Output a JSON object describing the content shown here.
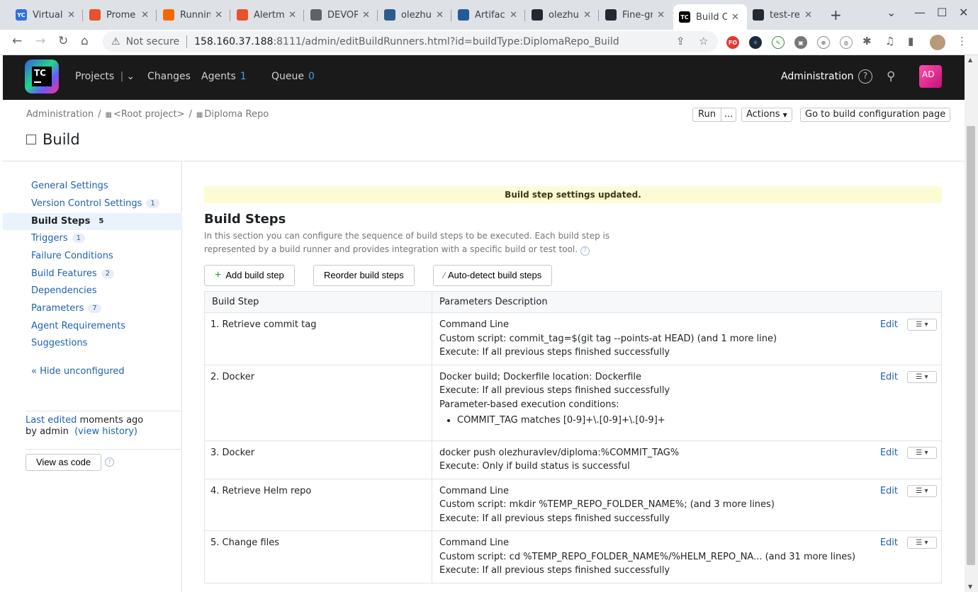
{
  "browser": {
    "tabs": [
      {
        "title": "Virtual",
        "icon": "yandex-cloud-icon",
        "color": "#2f6fe4",
        "glyph": "YC"
      },
      {
        "title": "Prome",
        "icon": "prometheus-icon",
        "color": "#e6522c",
        "glyph": ""
      },
      {
        "title": "Runnin",
        "icon": "grafana-icon",
        "color": "#f46800",
        "glyph": ""
      },
      {
        "title": "Alertm",
        "icon": "prometheus-icon",
        "color": "#e6522c",
        "glyph": ""
      },
      {
        "title": "DEVOP",
        "icon": "globe-icon",
        "color": "#5f6368",
        "glyph": ""
      },
      {
        "title": "olezhu",
        "icon": "docker-icon",
        "color": "#2e5c8a",
        "glyph": ""
      },
      {
        "title": "Artifac",
        "icon": "package-icon",
        "color": "#1f5c99",
        "glyph": ""
      },
      {
        "title": "olezhu",
        "icon": "github-icon",
        "color": "#24292f",
        "glyph": ""
      },
      {
        "title": "Fine-gr",
        "icon": "github-icon",
        "color": "#24292f",
        "glyph": ""
      },
      {
        "title": "Build C",
        "icon": "teamcity-icon",
        "color": "#000000",
        "glyph": "TC"
      },
      {
        "title": "test-re",
        "icon": "github-icon",
        "color": "#24292f",
        "glyph": ""
      }
    ],
    "not_secure": "Not secure",
    "url_host": "158.160.37.188",
    "url_rest": ":8111/admin/editBuildRunners.html?id=buildType:DiplomaRepo_Build"
  },
  "header": {
    "logo_text": "TC",
    "projects": "Projects",
    "changes": "Changes",
    "agents": "Agents",
    "agents_count": "1",
    "queue": "Queue",
    "queue_count": "0",
    "administration": "Administration",
    "avatar": "AD"
  },
  "breadcrumb": {
    "administration": "Administration",
    "root": "<Root project>",
    "project": "Diploma Repo"
  },
  "top_actions": {
    "run": "Run",
    "run_more": "...",
    "actions": "Actions",
    "goto": "Go to build configuration page"
  },
  "page_title": "Build",
  "sidebar": {
    "items": [
      {
        "label": "General Settings",
        "count": ""
      },
      {
        "label": "Version Control Settings",
        "count": "1"
      },
      {
        "label": "Build Steps",
        "count": "5"
      },
      {
        "label": "Triggers",
        "count": "1"
      },
      {
        "label": "Failure Conditions",
        "count": ""
      },
      {
        "label": "Build Features",
        "count": "2"
      },
      {
        "label": "Dependencies",
        "count": ""
      },
      {
        "label": "Parameters",
        "count": "7"
      },
      {
        "label": "Agent Requirements",
        "count": ""
      },
      {
        "label": "Suggestions",
        "count": ""
      }
    ],
    "hide_unconfigured": "« Hide unconfigured",
    "last_edited_link": "Last edited",
    "last_edited_rest": " moments ago",
    "by_admin": "by admin",
    "view_history": "(view history)",
    "view_as_code": "View as code"
  },
  "main": {
    "notice": "Build step settings updated.",
    "title": "Build Steps",
    "description": "In this section you can configure the sequence of build steps to be executed. Each build step is represented by a build runner and provides integration with a specific build or test tool.",
    "add_step": "Add build step",
    "reorder": "Reorder build steps",
    "autodetect": "Auto-detect build steps",
    "col_step": "Build Step",
    "col_params": "Parameters Description",
    "edit_label": "Edit",
    "steps": [
      {
        "name": "1. Retrieve commit tag",
        "lines": [
          "Command Line",
          "Custom script: commit_tag=$(git tag --points-at HEAD) (and 1 more line)",
          "Execute: If all previous steps finished successfully"
        ],
        "bullets": []
      },
      {
        "name": "2. Docker",
        "lines": [
          "Docker build; Dockerfile location: Dockerfile",
          "Execute: If all previous steps finished successfully",
          "Parameter-based execution conditions:"
        ],
        "bullets": [
          "COMMIT_TAG matches [0-9]+\\.[0-9]+\\.[0-9]+"
        ]
      },
      {
        "name": "3. Docker",
        "lines": [
          "docker push olezhuravlev/diploma:%COMMIT_TAG%",
          "Execute: Only if build status is successful"
        ],
        "bullets": []
      },
      {
        "name": "4. Retrieve Helm repo",
        "lines": [
          "Command Line",
          "Custom script: mkdir %TEMP_REPO_FOLDER_NAME%; (and 3 more lines)",
          "Execute: If all previous steps finished successfully"
        ],
        "bullets": []
      },
      {
        "name": "5. Change files",
        "lines": [
          "Command Line",
          "Custom script: cd %TEMP_REPO_FOLDER_NAME%/%HELM_REPO_NA... (and 31 more lines)",
          "Execute: If all previous steps finished successfully"
        ],
        "bullets": []
      }
    ]
  }
}
